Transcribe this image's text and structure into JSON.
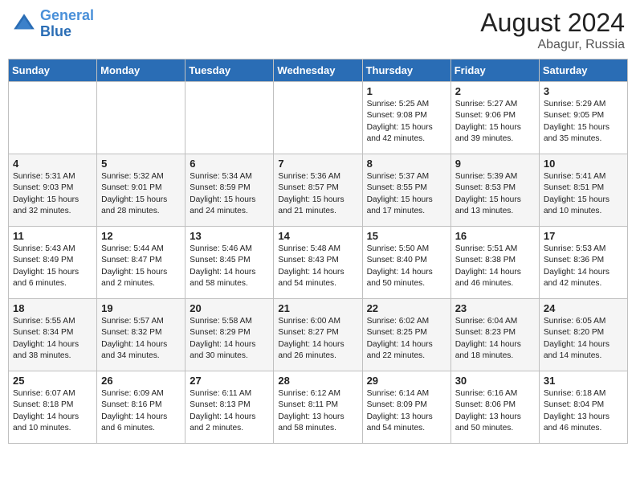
{
  "header": {
    "logo_line1": "General",
    "logo_line2": "Blue",
    "main_title": "August 2024",
    "sub_title": "Abagur, Russia"
  },
  "weekdays": [
    "Sunday",
    "Monday",
    "Tuesday",
    "Wednesday",
    "Thursday",
    "Friday",
    "Saturday"
  ],
  "weeks": [
    [
      {
        "day": "",
        "sunrise": "",
        "sunset": "",
        "daylight": ""
      },
      {
        "day": "",
        "sunrise": "",
        "sunset": "",
        "daylight": ""
      },
      {
        "day": "",
        "sunrise": "",
        "sunset": "",
        "daylight": ""
      },
      {
        "day": "",
        "sunrise": "",
        "sunset": "",
        "daylight": ""
      },
      {
        "day": "1",
        "sunrise": "Sunrise: 5:25 AM",
        "sunset": "Sunset: 9:08 PM",
        "daylight": "Daylight: 15 hours and 42 minutes."
      },
      {
        "day": "2",
        "sunrise": "Sunrise: 5:27 AM",
        "sunset": "Sunset: 9:06 PM",
        "daylight": "Daylight: 15 hours and 39 minutes."
      },
      {
        "day": "3",
        "sunrise": "Sunrise: 5:29 AM",
        "sunset": "Sunset: 9:05 PM",
        "daylight": "Daylight: 15 hours and 35 minutes."
      }
    ],
    [
      {
        "day": "4",
        "sunrise": "Sunrise: 5:31 AM",
        "sunset": "Sunset: 9:03 PM",
        "daylight": "Daylight: 15 hours and 32 minutes."
      },
      {
        "day": "5",
        "sunrise": "Sunrise: 5:32 AM",
        "sunset": "Sunset: 9:01 PM",
        "daylight": "Daylight: 15 hours and 28 minutes."
      },
      {
        "day": "6",
        "sunrise": "Sunrise: 5:34 AM",
        "sunset": "Sunset: 8:59 PM",
        "daylight": "Daylight: 15 hours and 24 minutes."
      },
      {
        "day": "7",
        "sunrise": "Sunrise: 5:36 AM",
        "sunset": "Sunset: 8:57 PM",
        "daylight": "Daylight: 15 hours and 21 minutes."
      },
      {
        "day": "8",
        "sunrise": "Sunrise: 5:37 AM",
        "sunset": "Sunset: 8:55 PM",
        "daylight": "Daylight: 15 hours and 17 minutes."
      },
      {
        "day": "9",
        "sunrise": "Sunrise: 5:39 AM",
        "sunset": "Sunset: 8:53 PM",
        "daylight": "Daylight: 15 hours and 13 minutes."
      },
      {
        "day": "10",
        "sunrise": "Sunrise: 5:41 AM",
        "sunset": "Sunset: 8:51 PM",
        "daylight": "Daylight: 15 hours and 10 minutes."
      }
    ],
    [
      {
        "day": "11",
        "sunrise": "Sunrise: 5:43 AM",
        "sunset": "Sunset: 8:49 PM",
        "daylight": "Daylight: 15 hours and 6 minutes."
      },
      {
        "day": "12",
        "sunrise": "Sunrise: 5:44 AM",
        "sunset": "Sunset: 8:47 PM",
        "daylight": "Daylight: 15 hours and 2 minutes."
      },
      {
        "day": "13",
        "sunrise": "Sunrise: 5:46 AM",
        "sunset": "Sunset: 8:45 PM",
        "daylight": "Daylight: 14 hours and 58 minutes."
      },
      {
        "day": "14",
        "sunrise": "Sunrise: 5:48 AM",
        "sunset": "Sunset: 8:43 PM",
        "daylight": "Daylight: 14 hours and 54 minutes."
      },
      {
        "day": "15",
        "sunrise": "Sunrise: 5:50 AM",
        "sunset": "Sunset: 8:40 PM",
        "daylight": "Daylight: 14 hours and 50 minutes."
      },
      {
        "day": "16",
        "sunrise": "Sunrise: 5:51 AM",
        "sunset": "Sunset: 8:38 PM",
        "daylight": "Daylight: 14 hours and 46 minutes."
      },
      {
        "day": "17",
        "sunrise": "Sunrise: 5:53 AM",
        "sunset": "Sunset: 8:36 PM",
        "daylight": "Daylight: 14 hours and 42 minutes."
      }
    ],
    [
      {
        "day": "18",
        "sunrise": "Sunrise: 5:55 AM",
        "sunset": "Sunset: 8:34 PM",
        "daylight": "Daylight: 14 hours and 38 minutes."
      },
      {
        "day": "19",
        "sunrise": "Sunrise: 5:57 AM",
        "sunset": "Sunset: 8:32 PM",
        "daylight": "Daylight: 14 hours and 34 minutes."
      },
      {
        "day": "20",
        "sunrise": "Sunrise: 5:58 AM",
        "sunset": "Sunset: 8:29 PM",
        "daylight": "Daylight: 14 hours and 30 minutes."
      },
      {
        "day": "21",
        "sunrise": "Sunrise: 6:00 AM",
        "sunset": "Sunset: 8:27 PM",
        "daylight": "Daylight: 14 hours and 26 minutes."
      },
      {
        "day": "22",
        "sunrise": "Sunrise: 6:02 AM",
        "sunset": "Sunset: 8:25 PM",
        "daylight": "Daylight: 14 hours and 22 minutes."
      },
      {
        "day": "23",
        "sunrise": "Sunrise: 6:04 AM",
        "sunset": "Sunset: 8:23 PM",
        "daylight": "Daylight: 14 hours and 18 minutes."
      },
      {
        "day": "24",
        "sunrise": "Sunrise: 6:05 AM",
        "sunset": "Sunset: 8:20 PM",
        "daylight": "Daylight: 14 hours and 14 minutes."
      }
    ],
    [
      {
        "day": "25",
        "sunrise": "Sunrise: 6:07 AM",
        "sunset": "Sunset: 8:18 PM",
        "daylight": "Daylight: 14 hours and 10 minutes."
      },
      {
        "day": "26",
        "sunrise": "Sunrise: 6:09 AM",
        "sunset": "Sunset: 8:16 PM",
        "daylight": "Daylight: 14 hours and 6 minutes."
      },
      {
        "day": "27",
        "sunrise": "Sunrise: 6:11 AM",
        "sunset": "Sunset: 8:13 PM",
        "daylight": "Daylight: 14 hours and 2 minutes."
      },
      {
        "day": "28",
        "sunrise": "Sunrise: 6:12 AM",
        "sunset": "Sunset: 8:11 PM",
        "daylight": "Daylight: 13 hours and 58 minutes."
      },
      {
        "day": "29",
        "sunrise": "Sunrise: 6:14 AM",
        "sunset": "Sunset: 8:09 PM",
        "daylight": "Daylight: 13 hours and 54 minutes."
      },
      {
        "day": "30",
        "sunrise": "Sunrise: 6:16 AM",
        "sunset": "Sunset: 8:06 PM",
        "daylight": "Daylight: 13 hours and 50 minutes."
      },
      {
        "day": "31",
        "sunrise": "Sunrise: 6:18 AM",
        "sunset": "Sunset: 8:04 PM",
        "daylight": "Daylight: 13 hours and 46 minutes."
      }
    ]
  ]
}
